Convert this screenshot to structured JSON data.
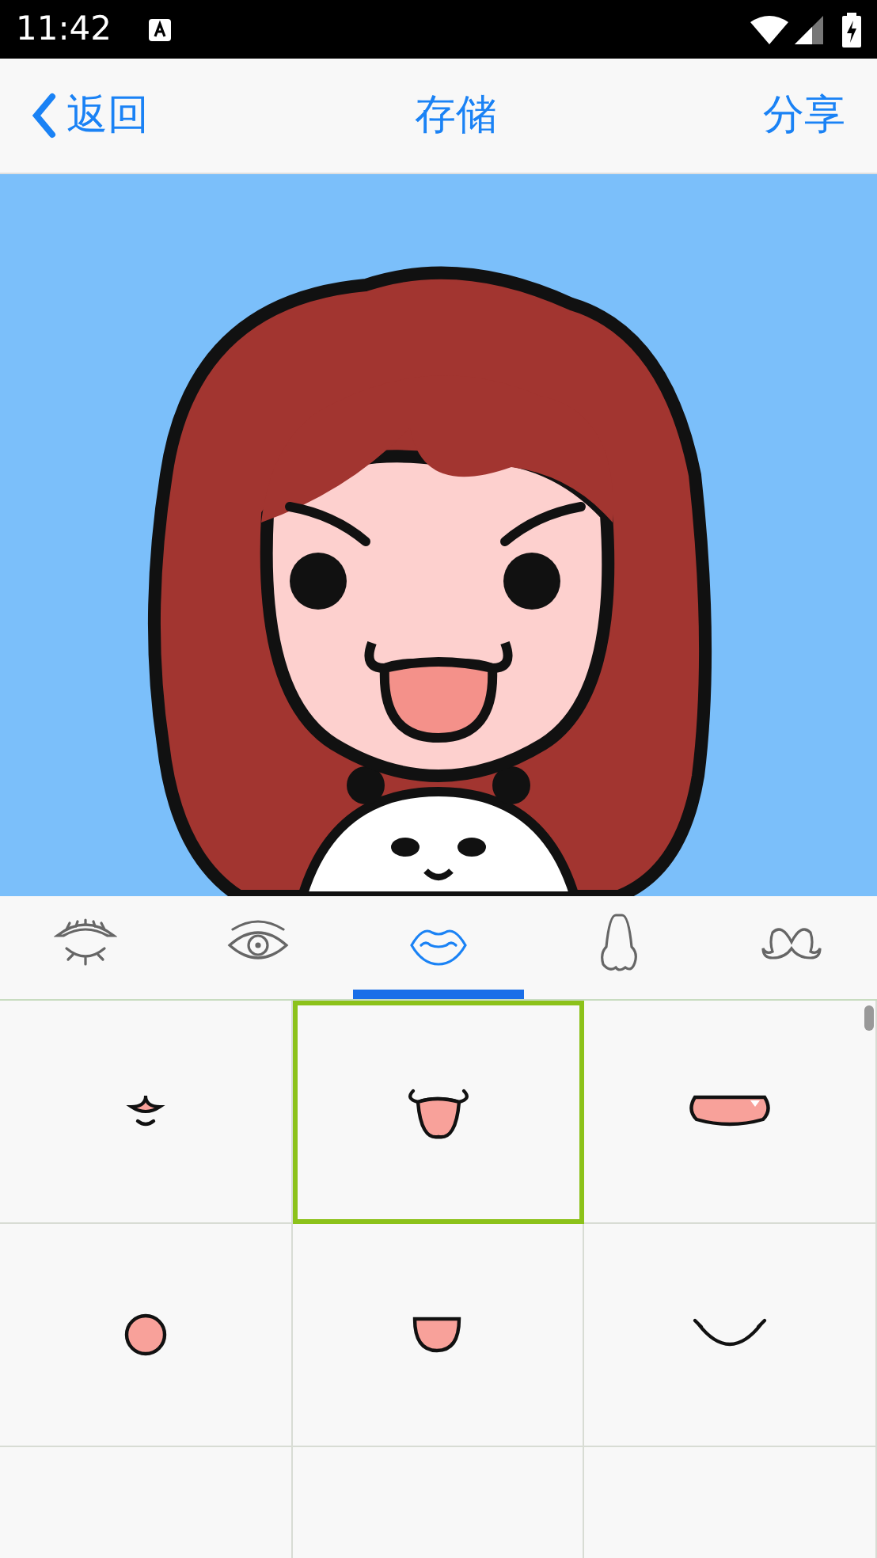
{
  "status_bar": {
    "time": "11:42"
  },
  "nav": {
    "back": "返回",
    "title": "存储",
    "action": "分享"
  },
  "tabs": [
    {
      "kind": "brow",
      "selected": false
    },
    {
      "kind": "eye",
      "selected": false
    },
    {
      "kind": "mouth",
      "selected": true
    },
    {
      "kind": "nose",
      "selected": false
    },
    {
      "kind": "mustache",
      "selected": false
    }
  ],
  "options": [
    {
      "kind": "tiny",
      "selected": false
    },
    {
      "kind": "tongue",
      "selected": true
    },
    {
      "kind": "grin",
      "selected": false
    },
    {
      "kind": "round",
      "selected": false
    },
    {
      "kind": "cup",
      "selected": false
    },
    {
      "kind": "smile",
      "selected": false
    },
    {
      "kind": "empty",
      "selected": false
    },
    {
      "kind": "empty",
      "selected": false
    },
    {
      "kind": "empty",
      "selected": false
    }
  ]
}
